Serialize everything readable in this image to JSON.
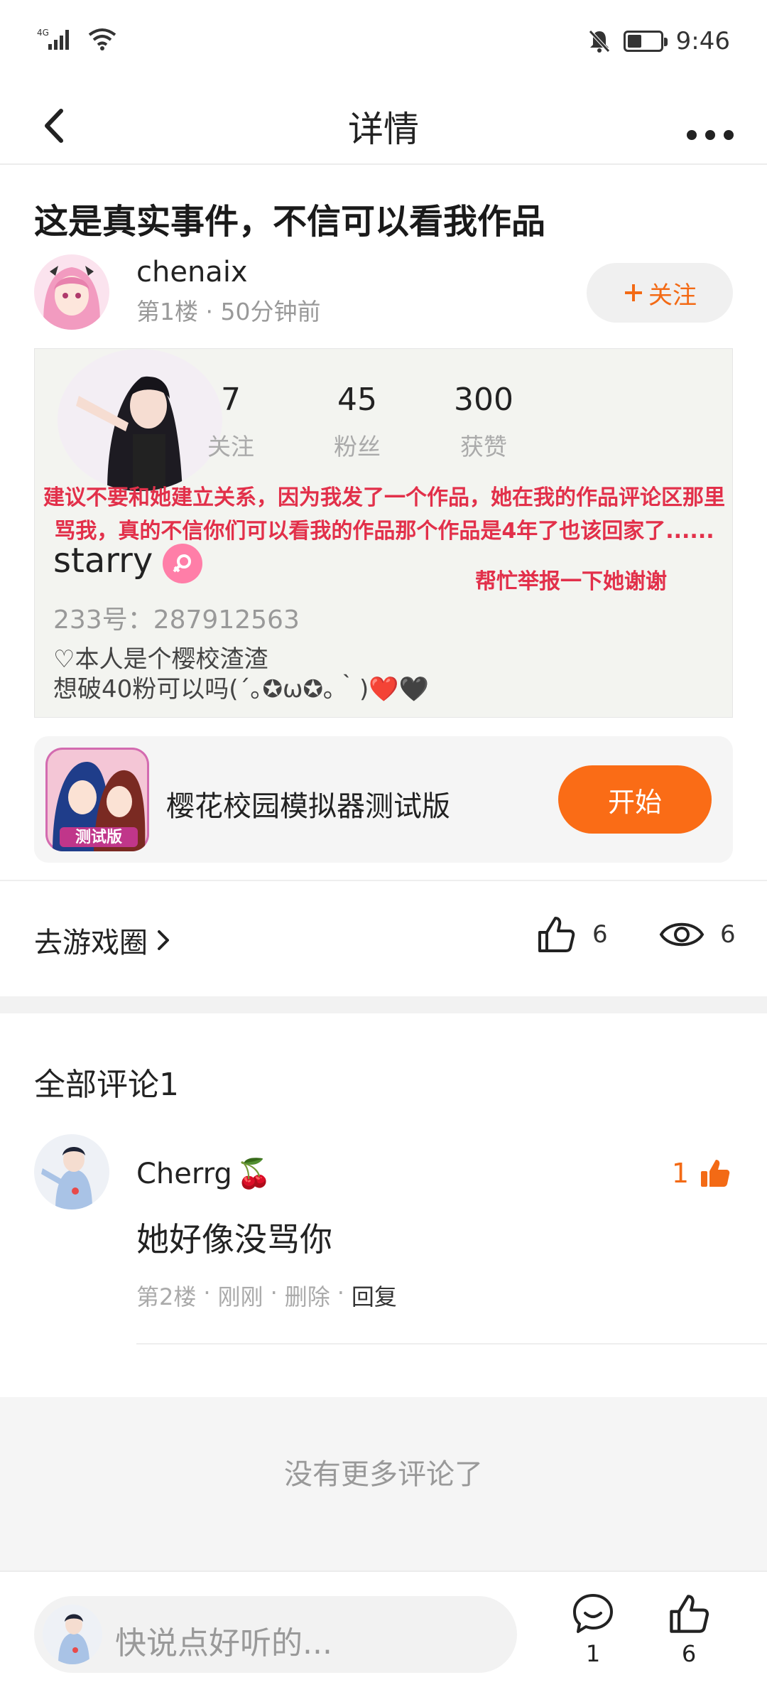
{
  "status_bar": {
    "network": "4G",
    "time": "9:46",
    "battery_level": 0.45
  },
  "nav": {
    "title": "详情"
  },
  "post": {
    "title": "这是真实事件，不信可以看我作品",
    "author": {
      "name": "chenaix",
      "meta": "第1楼 · 50分钟前"
    },
    "follow_label": "关注",
    "screenshot": {
      "stats": [
        {
          "value": "7",
          "label": "关注"
        },
        {
          "value": "45",
          "label": "粉丝"
        },
        {
          "value": "300",
          "label": "获赞"
        }
      ],
      "notice_text": "建议不要和她建立关系，因为我发了一个作品，她在我的作品评论区那里骂我，真的不信你们可以看我的作品那个作品是4年了也该回家了......",
      "notice_side": "帮忙举报一下她谢谢",
      "profile_name": "starry",
      "profile_id": "233号：287912563",
      "bio_line1": "♡本人是个樱校渣渣",
      "bio_line2": "想破40粉可以吗(´｡✪ω✪｡｀)❤️🖤"
    }
  },
  "game": {
    "name": "樱花校园模拟器测试版",
    "icon_label": "测试版",
    "start_label": "开始"
  },
  "actions": {
    "circle_link": "去游戏圈",
    "likes": "6",
    "views": "6"
  },
  "comments": {
    "header": "全部评论1",
    "items": [
      {
        "name": "Cherrg",
        "emoji": "🍒",
        "likes": "1",
        "text": "她好像没骂你",
        "floor": "第2楼",
        "time": "刚刚",
        "delete_label": "删除",
        "reply_label": "回复"
      }
    ],
    "no_more": "没有更多评论了"
  },
  "bottom_bar": {
    "placeholder": "快说点好听的...",
    "comment_count": "1",
    "like_count": "6"
  },
  "colors": {
    "accent": "#fa6c16",
    "notice_red": "#e2304a"
  }
}
